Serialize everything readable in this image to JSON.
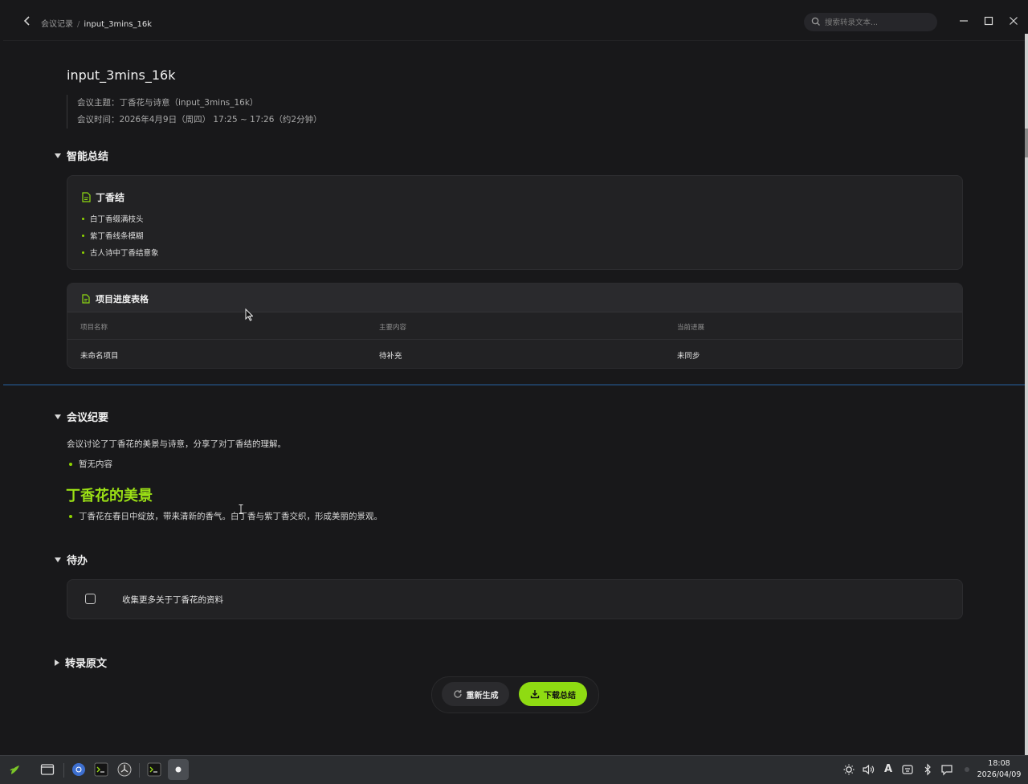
{
  "breadcrumb": {
    "parent": "会议记录",
    "separator": "/",
    "current": "input_3mins_16k"
  },
  "search": {
    "placeholder": "搜索转录文本..."
  },
  "window_controls": {
    "minimize": "—",
    "maximize": "□",
    "close": "✕"
  },
  "document": {
    "title": "input_3mins_16k",
    "topic": "会议主题：丁香花与诗意（input_3mins_16k）",
    "time": "会议时间：2026年4月9日（周四） 17:25 ~ 17:26（约2分钟）"
  },
  "smart_summary": {
    "heading": "智能总结",
    "card": {
      "title": "丁香结",
      "bullets": [
        "白丁香缀满枝头",
        "紫丁香线条模糊",
        "古人诗中丁香结意象"
      ]
    },
    "table": {
      "title": "项目进度表格",
      "columns": [
        "项目名称",
        "主要内容",
        "当前进展"
      ],
      "rows": [
        [
          "未命名项目",
          "待补充",
          "未同步"
        ]
      ]
    }
  },
  "minutes": {
    "heading": "会议纪要",
    "summary": "会议讨论了丁香花的美景与诗意，分享了对丁香结的理解。",
    "bullet": "暂无内容",
    "subheading": "丁香花的美景",
    "sub_bullet": "丁香花在春日中绽放，带来清新的香气。白丁香与紫丁香交织，形成美丽的景观。"
  },
  "todo": {
    "heading": "待办",
    "items": [
      {
        "text": "收集更多关于丁香花的资料",
        "checked": false
      }
    ]
  },
  "transcript": {
    "heading": "转录原文"
  },
  "actions": {
    "regenerate": "重新生成",
    "download": "下载总结"
  },
  "taskbar": {
    "time": "18:08",
    "date": "2026/04/09",
    "ime": "A"
  },
  "colors": {
    "accent": "#8fdb12",
    "background": "#18181a",
    "card": "#222224"
  }
}
